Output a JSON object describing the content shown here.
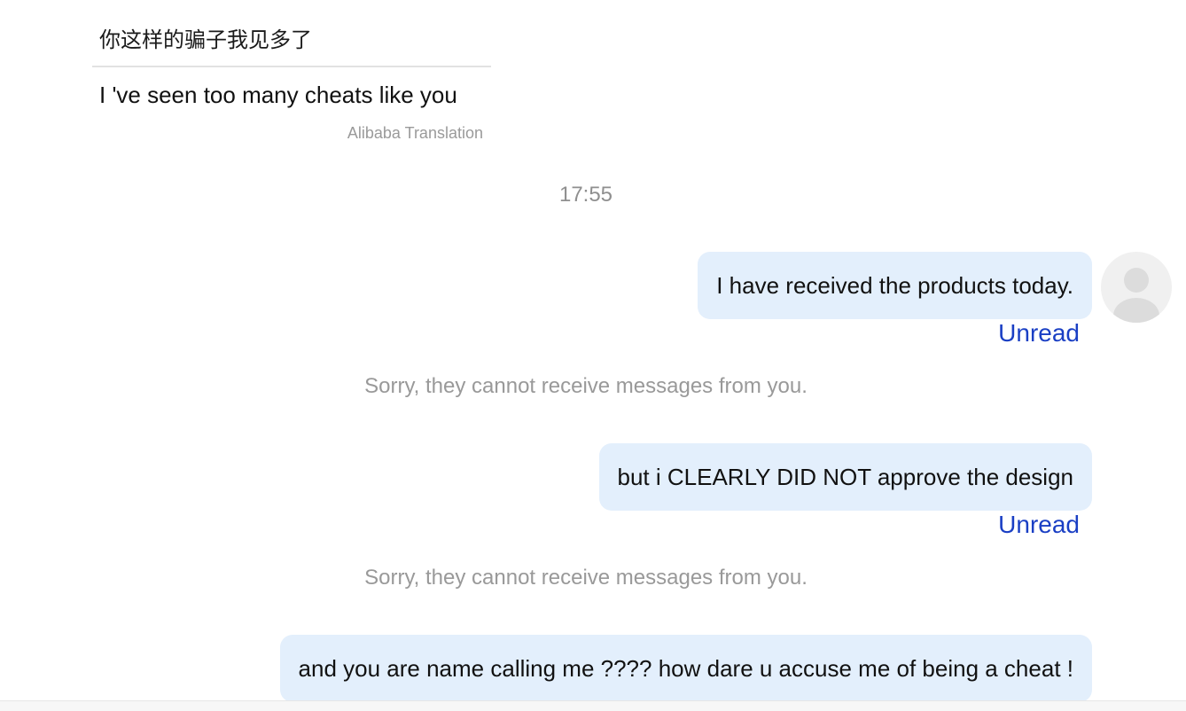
{
  "incoming": {
    "original": "你这样的骗子我见多了",
    "translation": "I 've seen too many cheats like you",
    "source": "Alibaba Translation"
  },
  "timestamp": "17:55",
  "messages": [
    {
      "text": "I have received the products today.",
      "status": "Unread",
      "notice": "Sorry, they cannot receive messages from you."
    },
    {
      "text": "but i CLEARLY DID NOT approve the design",
      "status": "Unread",
      "notice": "Sorry, they cannot receive messages from you."
    },
    {
      "text": "and you are name calling me ???? how dare u accuse me of being a cheat !"
    }
  ],
  "avatar": {
    "icon": "user-placeholder-icon"
  },
  "colors": {
    "bubble": "#e3effc",
    "unread_link": "#1a3fc4",
    "muted_text": "#999999"
  }
}
